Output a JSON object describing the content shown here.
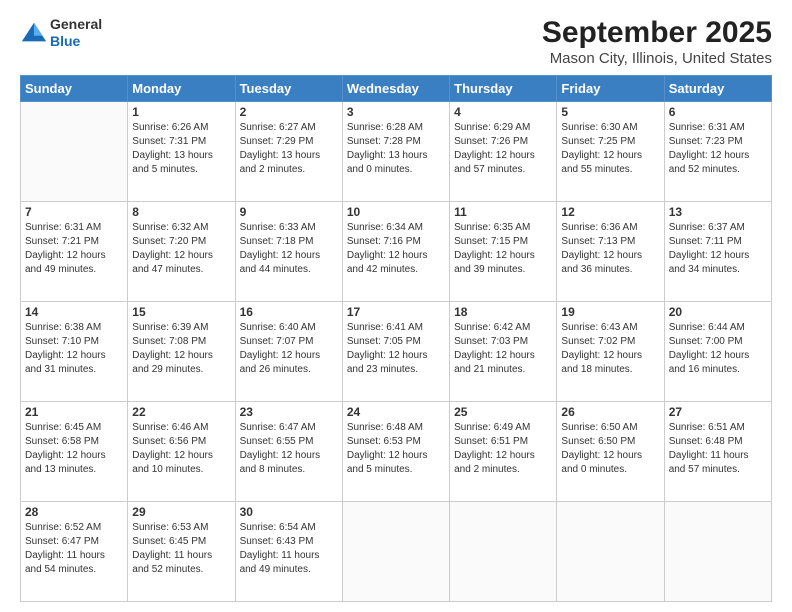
{
  "header": {
    "logo_general": "General",
    "logo_blue": "Blue",
    "title": "September 2025",
    "subtitle": "Mason City, Illinois, United States"
  },
  "days_of_week": [
    "Sunday",
    "Monday",
    "Tuesday",
    "Wednesday",
    "Thursday",
    "Friday",
    "Saturday"
  ],
  "weeks": [
    [
      {
        "day": "",
        "info": ""
      },
      {
        "day": "1",
        "info": "Sunrise: 6:26 AM\nSunset: 7:31 PM\nDaylight: 13 hours\nand 5 minutes."
      },
      {
        "day": "2",
        "info": "Sunrise: 6:27 AM\nSunset: 7:29 PM\nDaylight: 13 hours\nand 2 minutes."
      },
      {
        "day": "3",
        "info": "Sunrise: 6:28 AM\nSunset: 7:28 PM\nDaylight: 13 hours\nand 0 minutes."
      },
      {
        "day": "4",
        "info": "Sunrise: 6:29 AM\nSunset: 7:26 PM\nDaylight: 12 hours\nand 57 minutes."
      },
      {
        "day": "5",
        "info": "Sunrise: 6:30 AM\nSunset: 7:25 PM\nDaylight: 12 hours\nand 55 minutes."
      },
      {
        "day": "6",
        "info": "Sunrise: 6:31 AM\nSunset: 7:23 PM\nDaylight: 12 hours\nand 52 minutes."
      }
    ],
    [
      {
        "day": "7",
        "info": "Sunrise: 6:31 AM\nSunset: 7:21 PM\nDaylight: 12 hours\nand 49 minutes."
      },
      {
        "day": "8",
        "info": "Sunrise: 6:32 AM\nSunset: 7:20 PM\nDaylight: 12 hours\nand 47 minutes."
      },
      {
        "day": "9",
        "info": "Sunrise: 6:33 AM\nSunset: 7:18 PM\nDaylight: 12 hours\nand 44 minutes."
      },
      {
        "day": "10",
        "info": "Sunrise: 6:34 AM\nSunset: 7:16 PM\nDaylight: 12 hours\nand 42 minutes."
      },
      {
        "day": "11",
        "info": "Sunrise: 6:35 AM\nSunset: 7:15 PM\nDaylight: 12 hours\nand 39 minutes."
      },
      {
        "day": "12",
        "info": "Sunrise: 6:36 AM\nSunset: 7:13 PM\nDaylight: 12 hours\nand 36 minutes."
      },
      {
        "day": "13",
        "info": "Sunrise: 6:37 AM\nSunset: 7:11 PM\nDaylight: 12 hours\nand 34 minutes."
      }
    ],
    [
      {
        "day": "14",
        "info": "Sunrise: 6:38 AM\nSunset: 7:10 PM\nDaylight: 12 hours\nand 31 minutes."
      },
      {
        "day": "15",
        "info": "Sunrise: 6:39 AM\nSunset: 7:08 PM\nDaylight: 12 hours\nand 29 minutes."
      },
      {
        "day": "16",
        "info": "Sunrise: 6:40 AM\nSunset: 7:07 PM\nDaylight: 12 hours\nand 26 minutes."
      },
      {
        "day": "17",
        "info": "Sunrise: 6:41 AM\nSunset: 7:05 PM\nDaylight: 12 hours\nand 23 minutes."
      },
      {
        "day": "18",
        "info": "Sunrise: 6:42 AM\nSunset: 7:03 PM\nDaylight: 12 hours\nand 21 minutes."
      },
      {
        "day": "19",
        "info": "Sunrise: 6:43 AM\nSunset: 7:02 PM\nDaylight: 12 hours\nand 18 minutes."
      },
      {
        "day": "20",
        "info": "Sunrise: 6:44 AM\nSunset: 7:00 PM\nDaylight: 12 hours\nand 16 minutes."
      }
    ],
    [
      {
        "day": "21",
        "info": "Sunrise: 6:45 AM\nSunset: 6:58 PM\nDaylight: 12 hours\nand 13 minutes."
      },
      {
        "day": "22",
        "info": "Sunrise: 6:46 AM\nSunset: 6:56 PM\nDaylight: 12 hours\nand 10 minutes."
      },
      {
        "day": "23",
        "info": "Sunrise: 6:47 AM\nSunset: 6:55 PM\nDaylight: 12 hours\nand 8 minutes."
      },
      {
        "day": "24",
        "info": "Sunrise: 6:48 AM\nSunset: 6:53 PM\nDaylight: 12 hours\nand 5 minutes."
      },
      {
        "day": "25",
        "info": "Sunrise: 6:49 AM\nSunset: 6:51 PM\nDaylight: 12 hours\nand 2 minutes."
      },
      {
        "day": "26",
        "info": "Sunrise: 6:50 AM\nSunset: 6:50 PM\nDaylight: 12 hours\nand 0 minutes."
      },
      {
        "day": "27",
        "info": "Sunrise: 6:51 AM\nSunset: 6:48 PM\nDaylight: 11 hours\nand 57 minutes."
      }
    ],
    [
      {
        "day": "28",
        "info": "Sunrise: 6:52 AM\nSunset: 6:47 PM\nDaylight: 11 hours\nand 54 minutes."
      },
      {
        "day": "29",
        "info": "Sunrise: 6:53 AM\nSunset: 6:45 PM\nDaylight: 11 hours\nand 52 minutes."
      },
      {
        "day": "30",
        "info": "Sunrise: 6:54 AM\nSunset: 6:43 PM\nDaylight: 11 hours\nand 49 minutes."
      },
      {
        "day": "",
        "info": ""
      },
      {
        "day": "",
        "info": ""
      },
      {
        "day": "",
        "info": ""
      },
      {
        "day": "",
        "info": ""
      }
    ]
  ]
}
